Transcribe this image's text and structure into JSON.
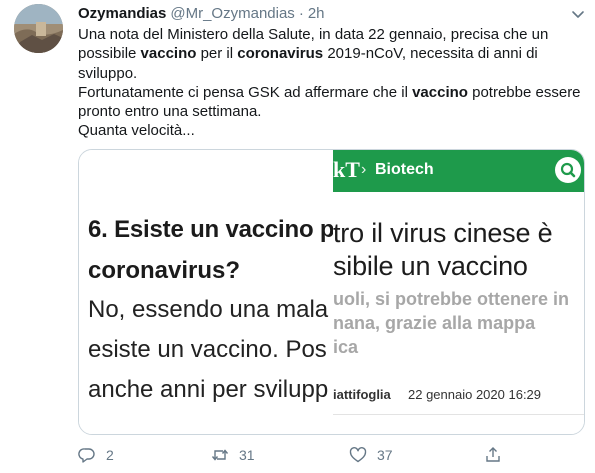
{
  "tweet": {
    "display_name": "Ozymandias",
    "handle": "@Mr_Ozymandias",
    "separator": "·",
    "time": "2h",
    "text": {
      "l1_a": "Una nota del Ministero della Salute, in data 22 gennaio, precisa che un",
      "l2_a": "possibile ",
      "l2_b": "vaccino",
      "l2_c": " per il ",
      "l2_d": "coronavirus",
      "l2_e": " 2019-nCoV, necessita di anni di",
      "l3": "sviluppo.",
      "l4": "Fortunatamente ci pensa GSK ad affermare che il ",
      "l4_b": "vaccino",
      "l4_c": " potrebbe essere",
      "l5": "pronto entro una settimana.",
      "l6": "Quanta velocità..."
    }
  },
  "media": {
    "left": {
      "line1": "6. Esiste un vaccino p",
      "line2": "coronavirus?",
      "line3": "No, essendo una mala",
      "line4": "esiste un vaccino. Pos",
      "line5": "anche anni per svilupp"
    },
    "right": {
      "logo_fragment": "kT",
      "breadcrumb_sep": "›",
      "breadcrumb": "Biotech",
      "headline1": "tro il virus cinese è",
      "headline2": "sibile un vaccino",
      "sub1": "uoli, si potrebbe ottenere in",
      "sub2": "nana, grazie alla mappa",
      "sub3": "ica",
      "author": "iattifoglia",
      "date": "22 gennaio 2020  16:29"
    }
  },
  "actions": {
    "reply_count": "2",
    "retweet_count": "31",
    "like_count": "37"
  },
  "icons": {
    "more": "chevron-down-icon",
    "reply": "reply-icon",
    "retweet": "retweet-icon",
    "like": "heart-icon",
    "share": "share-icon",
    "search": "search-icon"
  },
  "colors": {
    "accent_green": "#1e9a4b",
    "muted": "#657786"
  }
}
